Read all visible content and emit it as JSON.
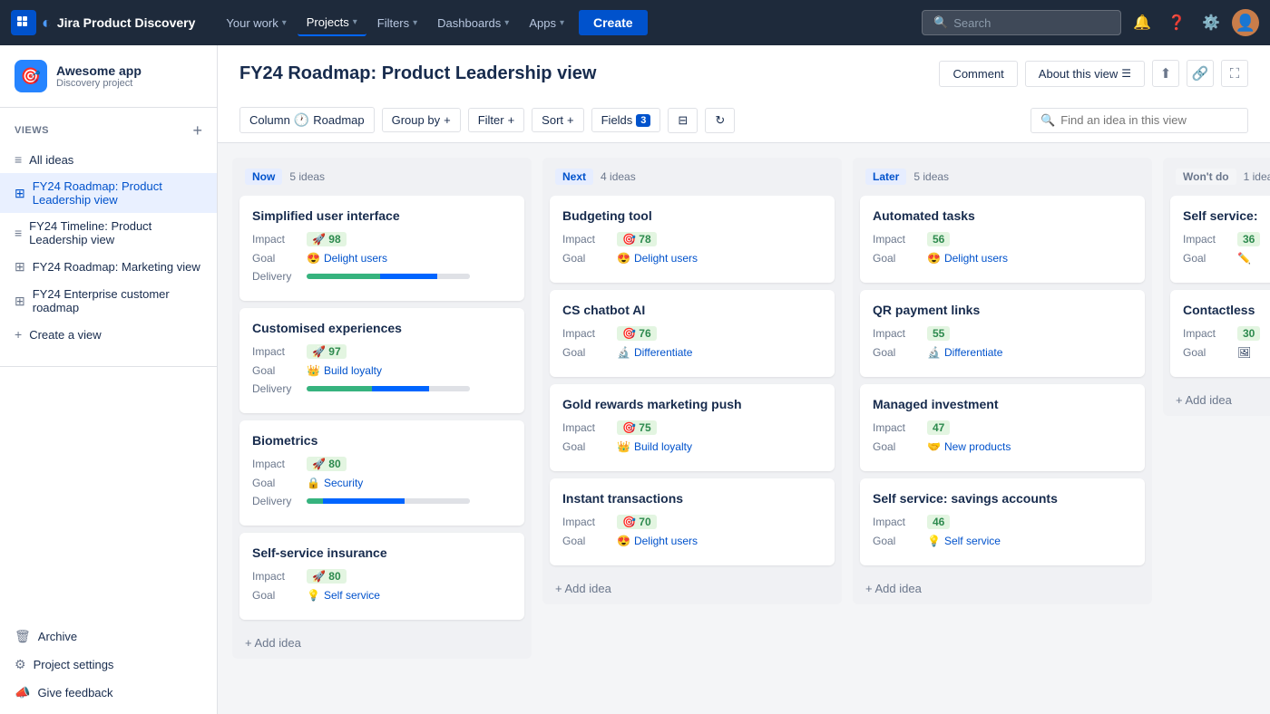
{
  "nav": {
    "logo_text": "Jira Product Discovery",
    "items": [
      {
        "label": "Your work",
        "id": "your-work"
      },
      {
        "label": "Projects",
        "id": "projects",
        "active": true
      },
      {
        "label": "Filters",
        "id": "filters"
      },
      {
        "label": "Dashboards",
        "id": "dashboards"
      },
      {
        "label": "Apps",
        "id": "apps"
      }
    ],
    "create_label": "Create",
    "search_placeholder": "Search",
    "icons": [
      "bell",
      "help",
      "settings"
    ]
  },
  "sidebar": {
    "project_name": "Awesome app",
    "project_sub": "Discovery project",
    "views_title": "VIEWS",
    "items": [
      {
        "label": "All ideas",
        "icon": "≡",
        "id": "all-ideas"
      },
      {
        "label": "FY24 Roadmap: Product Leadership view",
        "icon": "⊞",
        "id": "fy24-roadmap-plv",
        "active": true
      },
      {
        "label": "FY24 Timeline: Product Leadership view",
        "icon": "≡",
        "id": "fy24-timeline-plv"
      },
      {
        "label": "FY24 Roadmap: Marketing view",
        "icon": "⊞",
        "id": "fy24-roadmap-mv"
      },
      {
        "label": "FY24 Enterprise customer roadmap",
        "icon": "⊞",
        "id": "fy24-enterprise"
      },
      {
        "label": "Create a view",
        "icon": "+",
        "id": "create-view"
      }
    ],
    "bottom_items": [
      {
        "label": "Archive",
        "icon": "🗑",
        "id": "archive"
      },
      {
        "label": "Project settings",
        "icon": "⚙",
        "id": "project-settings"
      },
      {
        "label": "Give feedback",
        "icon": "📣",
        "id": "give-feedback"
      }
    ]
  },
  "page": {
    "title": "FY24 Roadmap: Product Leadership view",
    "comment_label": "Comment",
    "about_label": "About this view"
  },
  "toolbar": {
    "column_label": "Column",
    "roadmap_label": "Roadmap",
    "group_by_label": "Group by",
    "filter_label": "Filter",
    "sort_label": "Sort",
    "fields_label": "Fields",
    "fields_count": "3",
    "search_placeholder": "Find an idea in this view"
  },
  "columns": [
    {
      "id": "now",
      "label": "Now",
      "label_class": "now",
      "count": "5 ideas",
      "cards": [
        {
          "title": "Simplified user interface",
          "impact": "98",
          "impact_icon": "🚀",
          "goal": "Delight users",
          "goal_icon": "😍",
          "has_delivery": true,
          "delivery_green": 45,
          "delivery_blue": 35,
          "delivery_gray": 20
        },
        {
          "title": "Customised experiences",
          "impact": "97",
          "impact_icon": "🚀",
          "goal": "Build loyalty",
          "goal_icon": "👑",
          "has_delivery": true,
          "delivery_green": 40,
          "delivery_blue": 35,
          "delivery_gray": 25
        },
        {
          "title": "Biometrics",
          "impact": "80",
          "impact_icon": "🚀",
          "goal": "Security",
          "goal_icon": "🔒",
          "goal2": "",
          "goal2_icon": "",
          "has_delivery": true,
          "delivery_green": 10,
          "delivery_blue": 50,
          "delivery_gray": 40
        },
        {
          "title": "Self-service insurance",
          "impact": "80",
          "impact_icon": "🚀",
          "goal": "Self service",
          "goal_icon": "💡",
          "has_delivery": false
        }
      ]
    },
    {
      "id": "next",
      "label": "Next",
      "label_class": "next",
      "count": "4 ideas",
      "cards": [
        {
          "title": "Budgeting tool",
          "impact": "78",
          "impact_icon": "🎯",
          "goal": "Delight users",
          "goal_icon": "😍",
          "has_delivery": false
        },
        {
          "title": "CS chatbot AI",
          "impact": "76",
          "impact_icon": "🎯",
          "goal": "Differentiate",
          "goal_icon": "🔬",
          "has_delivery": false
        },
        {
          "title": "Gold rewards marketing push",
          "impact": "75",
          "impact_icon": "🎯",
          "goal": "Build loyalty",
          "goal_icon": "👑",
          "has_delivery": false
        },
        {
          "title": "Instant transactions",
          "impact": "70",
          "impact_icon": "🎯",
          "goal": "Delight users",
          "goal_icon": "😍",
          "has_delivery": false
        }
      ]
    },
    {
      "id": "later",
      "label": "Later",
      "label_class": "later",
      "count": "5 ideas",
      "cards": [
        {
          "title": "Automated tasks",
          "impact": "56",
          "impact_icon": "",
          "goal": "Delight users",
          "goal_icon": "😍",
          "has_delivery": false
        },
        {
          "title": "QR payment links",
          "impact": "55",
          "impact_icon": "",
          "goal": "Differentiate",
          "goal_icon": "🔬",
          "has_delivery": false
        },
        {
          "title": "Managed investment",
          "impact": "47",
          "impact_icon": "",
          "goal": "New products",
          "goal_icon": "🤝",
          "has_delivery": false
        },
        {
          "title": "Self service: savings accounts",
          "impact": "46",
          "impact_icon": "",
          "goal": "Self service",
          "goal_icon": "💡",
          "has_delivery": false
        }
      ]
    },
    {
      "id": "wontdo",
      "label": "Won't do",
      "label_class": "wontdo",
      "count": "1 idea",
      "cards": [
        {
          "title": "Self service:",
          "impact": "36",
          "goal_icon": "✏️",
          "has_delivery": false,
          "partial": true
        },
        {
          "title": "Contactless",
          "impact": "30",
          "goal_icon": "🖼",
          "has_delivery": false,
          "partial": true
        }
      ]
    }
  ],
  "add_idea_label": "+ Add idea"
}
